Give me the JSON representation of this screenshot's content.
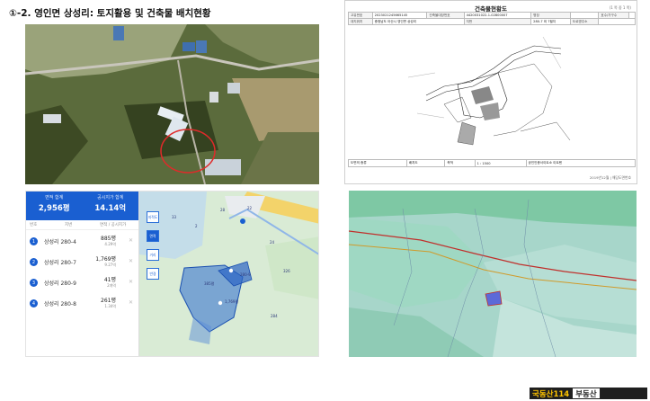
{
  "title": "①-2. 영인면 상성리: 토지활용 및 건축물 배치현황",
  "summary": {
    "area_label": "면적 합계",
    "area_value": "2,956평",
    "price_label": "공시지가 합계",
    "price_value": "14.14억",
    "cols": [
      "번호",
      "지번",
      "면적 / 공시지가"
    ]
  },
  "parcels": [
    {
      "no": "1",
      "addr": "상성리 280-4",
      "area": "885평",
      "price": "4.29억"
    },
    {
      "no": "2",
      "addr": "상성리 280-7",
      "area": "1,769평",
      "price": "9.27억"
    },
    {
      "no": "3",
      "addr": "상성리 280-9",
      "area": "41평",
      "price": "2개억"
    },
    {
      "no": "4",
      "addr": "상성리 280-8",
      "area": "261평",
      "price": "1.34억"
    }
  ],
  "map_tools": [
    "지적도",
    "면적",
    "거리",
    "반경"
  ],
  "map_labels": [
    "385평",
    "1,769평",
    "24",
    "280-9",
    "28",
    "2",
    "33",
    "22",
    "284",
    "326"
  ],
  "document": {
    "title": "건축물현황도",
    "page": "(1 쪽 중 1 쪽)",
    "row1_lab": [
      "고유번호",
      "건축물대장번호",
      "명칭",
      "호수/가구수"
    ],
    "row1_val": [
      "4420031022-1-02800007",
      "2023021245665145",
      "",
      ""
    ],
    "row2_lab": [
      "대지위치",
      "지번",
      "도로명주소"
    ],
    "row2_val": [
      "충청남도 아산시 영인면 상성리",
      "280-7 외 7필지",
      ""
    ],
    "foot_lab": [
      "도면의 종류",
      "축척"
    ],
    "foot_val": [
      "배치도",
      "1 : 1500"
    ],
    "foot_org": "공인인증서이트소 이트텐",
    "bottom_note": "2019년12월 | 해당도면번호"
  },
  "brand": {
    "name": "국동산114",
    "tag": "부동산"
  }
}
